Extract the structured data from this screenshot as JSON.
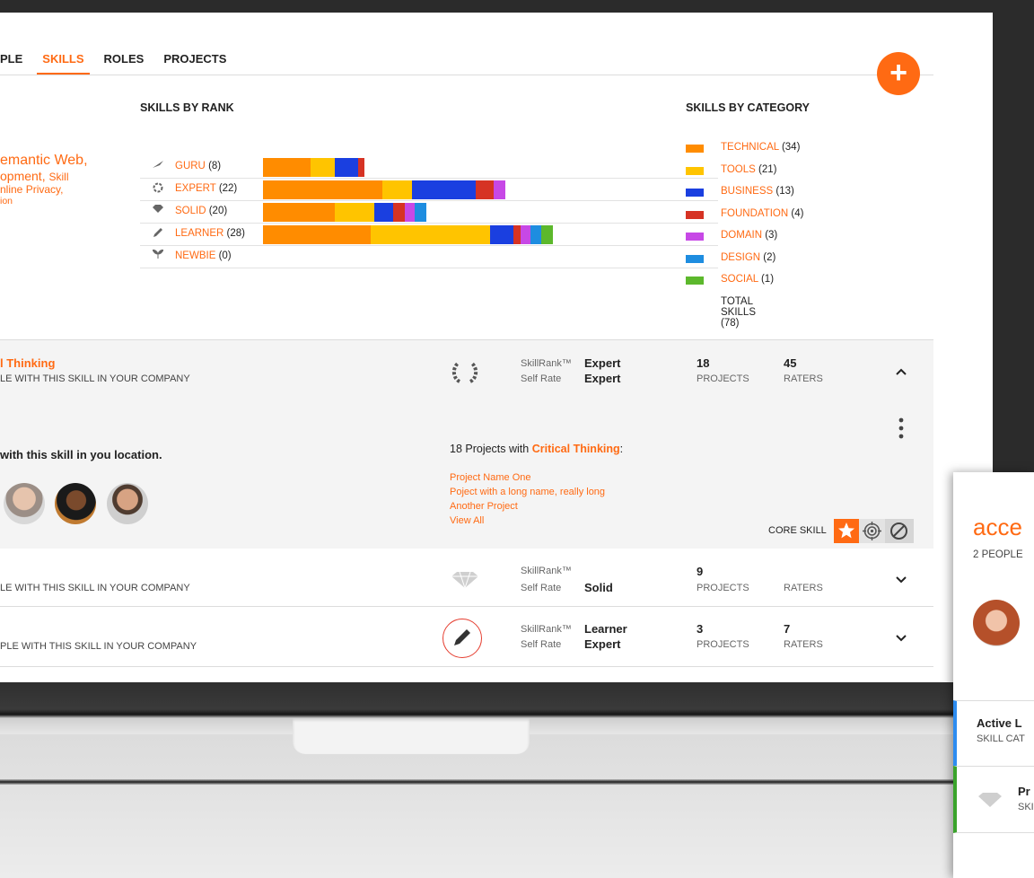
{
  "tabs": [
    {
      "label": "PLE",
      "active": false
    },
    {
      "label": "SKILLS",
      "active": true
    },
    {
      "label": "ROLES",
      "active": false
    },
    {
      "label": "PROJECTS",
      "active": false
    }
  ],
  "fab_label": "+",
  "left_links": {
    "line1": "emantic Web,",
    "line2a": "opment,",
    "line2b": "Skill",
    "line3": "nline Privacy,",
    "line4": "ion"
  },
  "skills_by_rank": {
    "title": "SKILLS BY RANK",
    "ranks": [
      {
        "label": "GURU",
        "count": "(8)",
        "icon": "flag-icon"
      },
      {
        "label": "EXPERT",
        "count": "(22)",
        "icon": "laurel-icon"
      },
      {
        "label": "SOLID",
        "count": "(20)",
        "icon": "diamond-icon"
      },
      {
        "label": "LEARNER",
        "count": "(28)",
        "icon": "pencil-icon"
      },
      {
        "label": "NEWBIE",
        "count": "(0)",
        "icon": "sprout-icon"
      }
    ]
  },
  "chart_data": {
    "type": "bar",
    "stacked": true,
    "orientation": "horizontal",
    "title": "SKILLS BY RANK",
    "categories": [
      "GURU (8)",
      "EXPERT (22)",
      "SOLID (20)",
      "LEARNER (28)",
      "NEWBIE (0)"
    ],
    "series": [
      {
        "name": "TECHNICAL",
        "color": "#ff8c00",
        "values": [
          4,
          10,
          6,
          9,
          0
        ]
      },
      {
        "name": "TOOLS",
        "color": "#ffc400",
        "values": [
          2,
          2.5,
          3.3,
          10,
          0
        ]
      },
      {
        "name": "BUSINESS",
        "color": "#1a3fe0",
        "values": [
          2,
          5.3,
          1.6,
          2,
          0
        ]
      },
      {
        "name": "FOUNDATION",
        "color": "#d63324",
        "values": [
          0.5,
          1.5,
          1,
          0.6,
          0
        ]
      },
      {
        "name": "DOMAIN",
        "color": "#c748e6",
        "values": [
          0,
          1,
          0.8,
          0.8,
          0
        ]
      },
      {
        "name": "DESIGN",
        "color": "#1e8de0",
        "values": [
          0,
          0,
          1,
          0.9,
          0
        ]
      },
      {
        "name": "SOCIAL",
        "color": "#5cb82c",
        "values": [
          0,
          0,
          0,
          1,
          0
        ]
      }
    ]
  },
  "skills_by_category": {
    "title": "SKILLS BY CATEGORY",
    "items": [
      {
        "label": "TECHNICAL",
        "count": "(34)",
        "color": "#ff8c00"
      },
      {
        "label": "TOOLS",
        "count": "(21)",
        "color": "#ffc400"
      },
      {
        "label": "BUSINESS",
        "count": "(13)",
        "color": "#1a3fe0"
      },
      {
        "label": "FOUNDATION",
        "count": "(4)",
        "color": "#d63324"
      },
      {
        "label": "DOMAIN",
        "count": "(3)",
        "color": "#c748e6"
      },
      {
        "label": "DESIGN",
        "count": "(2)",
        "color": "#1e8de0"
      },
      {
        "label": "SOCIAL",
        "count": "(1)",
        "color": "#5cb82c"
      }
    ],
    "total": "TOTAL SKILLS (78)"
  },
  "expanded_skill": {
    "name": "l Thinking",
    "subtitle": "LE WITH THIS SKILL IN YOUR COMPANY",
    "skillrank_label": "SkillRank™",
    "skillrank_value": "Expert",
    "selfrate_label": "Self Rate",
    "selfrate_value": "Expert",
    "projects_num": "18",
    "projects_label": "PROJECTS",
    "raters_num": "45",
    "raters_label": "RATERS",
    "people_heading": "with this skill in you location.",
    "projects_heading_prefix": "18 Projects with",
    "projects_heading_skill": "Critical Thinking",
    "projects_heading_suffix": ":",
    "projects": [
      "Project Name One",
      "Poject with a long name, really long",
      "Another Project",
      "View All"
    ],
    "core_skill_label": "CORE SKILL"
  },
  "skill_rows": [
    {
      "subtitle": "LE WITH THIS SKILL IN YOUR COMPANY",
      "skillrank_label": "SkillRank™",
      "skillrank_value": "",
      "selfrate_label": "Self Rate",
      "selfrate_value": "Solid",
      "projects_num": "9",
      "projects_label": "PROJECTS",
      "raters_num": "",
      "raters_label": "RATERS"
    },
    {
      "subtitle": "PLE WITH THIS SKILL IN YOUR COMPANY",
      "skillrank_label": "SkillRank™",
      "skillrank_value": "Learner",
      "selfrate_label": "Self Rate",
      "selfrate_value": "Expert",
      "projects_num": "3",
      "projects_label": "PROJECTS",
      "raters_num": "7",
      "raters_label": "RATERS"
    }
  ],
  "side_card": {
    "title": "acce",
    "people": "2 PEOPLE",
    "item1_title": "Active L",
    "item1_sub": "SKILL CAT",
    "item2_title": "Pr",
    "item2_sub": "SKI"
  }
}
